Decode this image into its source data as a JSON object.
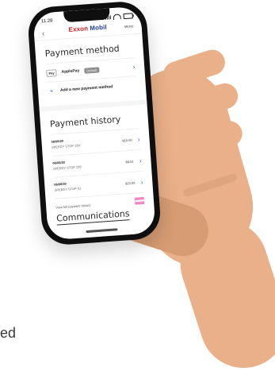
{
  "status": {
    "time": "11:28"
  },
  "brand": {
    "part1": "Exxon",
    "part2": "Mobil",
    "right_label": "MENU"
  },
  "payment_method": {
    "title": "Payment method",
    "method": {
      "logo": "Pay",
      "name": "ApplePay",
      "badge": "Default"
    },
    "add_label": "Add a new payment method"
  },
  "payment_history": {
    "title": "Payment history",
    "items": [
      {
        "date": "06/08/20",
        "merchant": "SPEEDY STOP 199",
        "amount": "$10.00"
      },
      {
        "date": "06/06/20",
        "merchant": "SPEEDY STOP 199",
        "amount": "$8.01"
      },
      {
        "date": "06/06/20",
        "merchant": "SPEEDY STOP 91",
        "amount": "$22.00"
      }
    ],
    "view_all": "View full payment history"
  },
  "communications": {
    "title": "Communications"
  },
  "page": {
    "partial_text": "ed"
  },
  "icons": {
    "back": "chevron-left-icon",
    "chevron": "chevron-right-icon",
    "plus": "plus-icon"
  }
}
